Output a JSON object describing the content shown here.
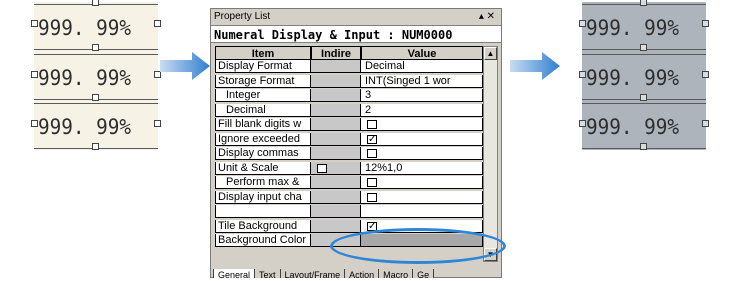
{
  "left_panel": {
    "values": [
      "999. 99%",
      "999. 99%",
      "999. 99%"
    ]
  },
  "right_panel": {
    "values": [
      "999. 99%",
      "999. 99%",
      "999. 99%"
    ]
  },
  "window": {
    "title": "Property List",
    "controls": "▴ ✕",
    "header": "Numeral Display & Input : NUM0000",
    "columns": [
      "Item",
      "Indire",
      "Value"
    ],
    "rows": [
      {
        "item": "Display Format",
        "value": "Decimal",
        "cb_value": false,
        "cb_ind": false
      },
      {
        "item": "Storage Format",
        "value": "INT(Singed 1 wor",
        "cb_value": false,
        "cb_ind": false
      },
      {
        "item": "Integer",
        "value": "3",
        "indent": true
      },
      {
        "item": "Decimal",
        "value": "2",
        "indent": true
      },
      {
        "item": "Fill blank digits w",
        "value": "",
        "cb_value": true,
        "checked": false
      },
      {
        "item": "Ignore exceeded",
        "value": "",
        "cb_value": true,
        "checked": true
      },
      {
        "item": "Display commas",
        "value": "",
        "cb_value": true,
        "checked": false
      },
      {
        "item": "Unit & Scale",
        "value": "12%1,0",
        "cb_ind": true
      },
      {
        "item": "Perform max &",
        "value": "",
        "cb_value": true,
        "checked": false,
        "indent": true
      },
      {
        "item": "Display input cha",
        "value": "",
        "cb_value": true,
        "checked": false
      },
      {
        "item": "",
        "value": ""
      },
      {
        "item": "Tile Background",
        "value": "",
        "cb_value": true,
        "checked": true
      },
      {
        "item": "Background Color",
        "value": "",
        "gray_value": true
      }
    ],
    "tabs": [
      "General",
      "Text",
      "Layout/Frame",
      "Action",
      "Macro",
      "Ge"
    ],
    "active_tab": "General",
    "checkmark": "✓"
  },
  "colors": {
    "left_panel_bg": "#f6f3e6",
    "right_panel_bg": "#aeb4bb",
    "arrow": "#2f7fd0",
    "highlight_ellipse": "#2e86d6"
  }
}
